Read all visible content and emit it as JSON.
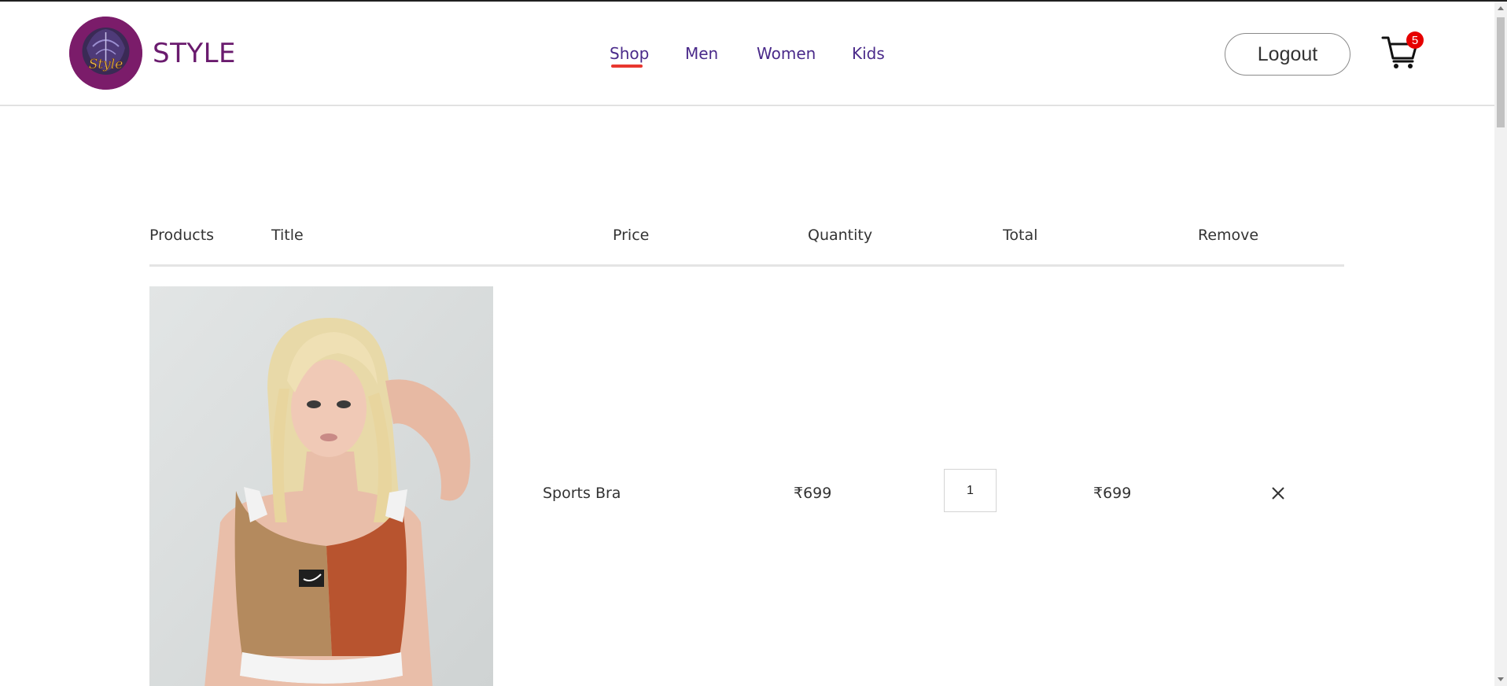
{
  "header": {
    "brand": "STYLE",
    "logo_text": "Style",
    "nav": [
      {
        "label": "Shop",
        "active": true
      },
      {
        "label": "Men",
        "active": false
      },
      {
        "label": "Women",
        "active": false
      },
      {
        "label": "Kids",
        "active": false
      }
    ],
    "logout_label": "Logout",
    "cart_count": "5"
  },
  "cart_table": {
    "columns": [
      "Products",
      "Title",
      "Price",
      "Quantity",
      "Total",
      "Remove"
    ],
    "rows": [
      {
        "title": "Sports Bra",
        "price": "₹699",
        "quantity": "1",
        "total": "₹699"
      }
    ]
  },
  "colors": {
    "brand_purple": "#6a1b6e",
    "nav_text": "#4a2a8a",
    "active_underline": "#e8372f",
    "badge_red": "#e60000"
  },
  "icons": {
    "cart": "cart-icon",
    "remove": "close-icon"
  }
}
